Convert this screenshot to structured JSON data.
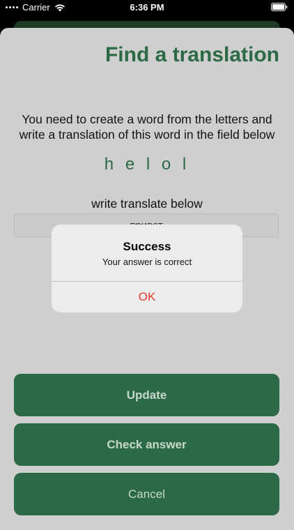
{
  "status_bar": {
    "carrier": "Carrier",
    "time": "6:36 PM",
    "wifi_icon": "wifi-icon",
    "battery_icon": "battery-icon"
  },
  "screen": {
    "title": "Find a translation",
    "instructions": "You need to create a word from the letters and write a translation of this word in the field below",
    "scrambled_word": "h e l o l",
    "field_label": "write translate below",
    "answer_value": "привет"
  },
  "buttons": {
    "update": "Update",
    "check_answer": "Check answer",
    "cancel": "Cancel"
  },
  "alert": {
    "title": "Success",
    "message": "Your answer is correct",
    "ok": "OK"
  },
  "colors": {
    "accent": "#2b6a45",
    "alert_action": "#e5382e",
    "sheet_background": "#cfcfcf"
  }
}
